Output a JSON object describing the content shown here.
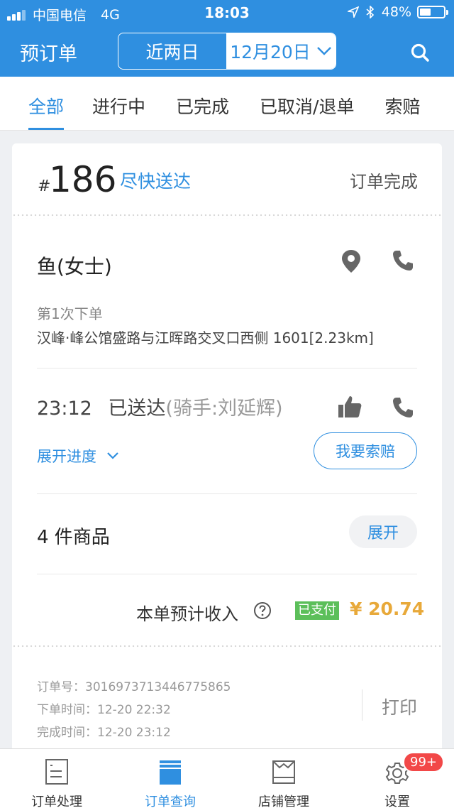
{
  "status_bar": {
    "carrier": "中国电信",
    "network": "4G",
    "time": "18:03",
    "battery": "48%",
    "battery_level": 0.48
  },
  "header": {
    "title": "预订单",
    "range_option": "近两日",
    "date": "12月20日"
  },
  "tabs": [
    {
      "label": "全部",
      "active": true
    },
    {
      "label": "进行中",
      "active": false
    },
    {
      "label": "已完成",
      "active": false
    },
    {
      "label": "已取消/退单",
      "active": false
    },
    {
      "label": "索赔",
      "active": false
    }
  ],
  "order": {
    "hash": "#",
    "number": "186",
    "tag": "尽快送达",
    "status": "订单完成",
    "customer_name": "鱼(女士)",
    "order_count": "第1次下单",
    "address": "汉峰·峰公馆盛路与江晖路交叉口西侧 1601[2.23km]",
    "delivered_time": "23:12",
    "delivered_status": "已送达",
    "rider": "(骑手:刘延辉)",
    "expand_progress": "展开进度",
    "claim_button": "我要索赔",
    "goods_count": "4 件商品",
    "goods_expand": "展开",
    "income_label": "本单预计收入",
    "paid_badge": "已支付",
    "amount": "¥ 20.74",
    "order_no": "订单号：3016973713446775865",
    "placed_time": "下单时间：12-20 22:32",
    "completed_time": "完成时间：12-20 23:12",
    "print_button": "打印"
  },
  "bottom_nav": [
    {
      "label": "订单处理",
      "icon": "order-list-icon"
    },
    {
      "label": "订单查询",
      "icon": "order-query-icon",
      "active": true
    },
    {
      "label": "店铺管理",
      "icon": "shop-icon"
    },
    {
      "label": "设置",
      "icon": "gear-icon",
      "badge": "99+"
    }
  ],
  "colors": {
    "primary": "#2f8fe0",
    "paid": "#5cbf5a",
    "amount": "#e8a93a",
    "badge": "#f24848"
  }
}
